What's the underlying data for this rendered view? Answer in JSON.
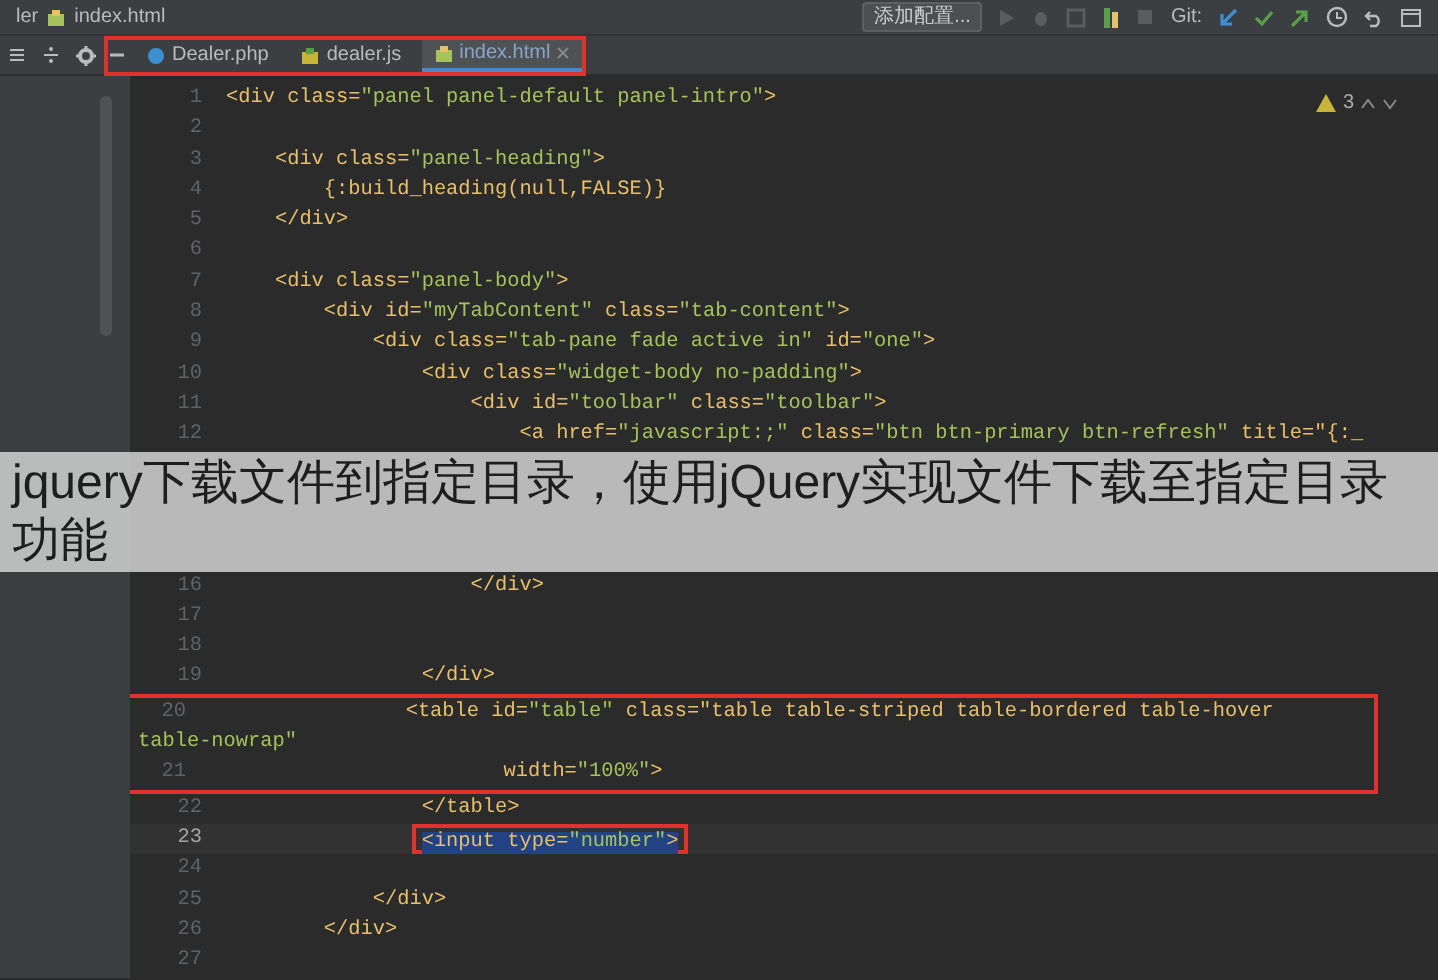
{
  "breadcrumb": [
    "ler",
    "index.html"
  ],
  "toolbar": {
    "config_button": "添加配置...",
    "git_label": "Git:"
  },
  "tabs_framed": true,
  "tabs": [
    {
      "label": "Dealer.php",
      "kind": "php",
      "selected": false
    },
    {
      "label": "dealer.js",
      "kind": "js",
      "selected": false
    },
    {
      "label": "index.html",
      "kind": "html",
      "selected": true
    }
  ],
  "inspections": {
    "count": "3"
  },
  "lines": [
    {
      "kind": "line",
      "number": "1",
      "code": "<div class=\"panel panel-default panel-intro\">",
      "selected": false,
      "framed": false
    },
    {
      "kind": "line",
      "number": "2",
      "selected": false,
      "framed": false
    },
    {
      "kind": "line",
      "number": "3",
      "code": "    <div class=\"panel-heading\">",
      "selected": false,
      "framed": false
    },
    {
      "kind": "line",
      "number": "4",
      "code": "        {:build_heading(null,FALSE)}",
      "selected": false,
      "framed": false
    },
    {
      "kind": "line",
      "number": "5",
      "code": "    </div>",
      "selected": false,
      "framed": false
    },
    {
      "kind": "line",
      "number": "6",
      "selected": false,
      "framed": false
    },
    {
      "kind": "line",
      "number": "7",
      "code": "    <div class=\"panel-body\">",
      "selected": false,
      "framed": false
    },
    {
      "kind": "line",
      "number": "8",
      "code": "        <div id=\"myTabContent\" class=\"tab-content\">",
      "selected": false,
      "framed": false
    },
    {
      "kind": "line",
      "number": "9",
      "code": "            <div class=\"tab-pane fade active in\" id=\"one\">",
      "selected": false,
      "framed": false
    },
    {
      "kind": "line",
      "number": "10",
      "code": "                <div class=\"widget-body no-padding\">",
      "selected": false,
      "framed": false
    },
    {
      "kind": "line",
      "number": "11",
      "code": "                    <div id=\"toolbar\" class=\"toolbar\">",
      "selected": false,
      "framed": false
    },
    {
      "kind": "line",
      "number": "12",
      "code": "                        <a href=\"javascript:;\" class=\"btn btn-primary btn-refresh\" title=\"{:_",
      "selected": false,
      "framed": false
    },
    {
      "kind": "banner",
      "text": "jquery下载文件到指定目录，使用jQuery实现文件下载至指定目录功能"
    },
    {
      "kind": "line",
      "number": "16",
      "code": "                    </div>",
      "selected": false,
      "framed": false
    },
    {
      "kind": "line",
      "number": "17",
      "selected": false,
      "framed": false
    },
    {
      "kind": "line",
      "number": "18",
      "selected": false,
      "framed": false
    },
    {
      "kind": "line",
      "number": "19",
      "code": "                </div>",
      "selected": false,
      "framed": false
    },
    {
      "kind": "frame",
      "lines": [
        {
          "kind": "line",
          "number": "20",
          "code": "                <table id=\"table\" class=\"table table-striped table-bordered table-hover",
          "selected": false,
          "framed": false
        },
        {
          "kind": "wrap",
          "code": "table-nowrap\""
        },
        {
          "kind": "line",
          "number": "21",
          "code": "                        width=\"100%\">",
          "selected": false,
          "framed": false
        }
      ]
    },
    {
      "kind": "line",
      "number": "22",
      "code": "                </table>",
      "selected": false,
      "framed": false
    },
    {
      "kind": "line",
      "number": "23",
      "code": "                <input type=\"number\">",
      "selected": true,
      "framed": true
    },
    {
      "kind": "line",
      "number": "24",
      "selected": false,
      "framed": false
    },
    {
      "kind": "line",
      "number": "25",
      "code": "            </div>",
      "selected": false,
      "framed": false
    },
    {
      "kind": "line",
      "number": "26",
      "code": "        </div>",
      "selected": false,
      "framed": false
    },
    {
      "kind": "line",
      "number": "27",
      "selected": false,
      "framed": false
    }
  ]
}
